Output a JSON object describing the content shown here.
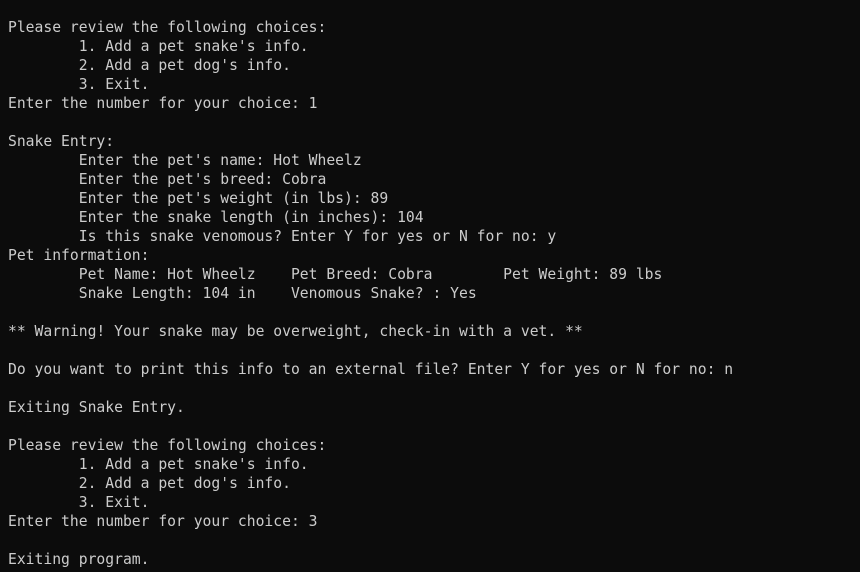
{
  "terminal": {
    "lines": [
      "Please review the following choices:",
      "        1. Add a pet snake's info.",
      "        2. Add a pet dog's info.",
      "        3. Exit.",
      "Enter the number for your choice: 1",
      "",
      "Snake Entry:",
      "        Enter the pet's name: Hot Wheelz",
      "        Enter the pet's breed: Cobra",
      "        Enter the pet's weight (in lbs): 89",
      "        Enter the snake length (in inches): 104",
      "        Is this snake venomous? Enter Y for yes or N for no: y",
      "Pet information:",
      "        Pet Name: Hot Wheelz    Pet Breed: Cobra        Pet Weight: 89 lbs",
      "        Snake Length: 104 in    Venomous Snake? : Yes",
      "",
      "** Warning! Your snake may be overweight, check-in with a vet. **",
      "",
      "Do you want to print this info to an external file? Enter Y for yes or N for no: n",
      "",
      "Exiting Snake Entry.",
      "",
      "Please review the following choices:",
      "        1. Add a pet snake's info.",
      "        2. Add a pet dog's info.",
      "        3. Exit.",
      "Enter the number for your choice: 3",
      "",
      "Exiting program."
    ]
  }
}
